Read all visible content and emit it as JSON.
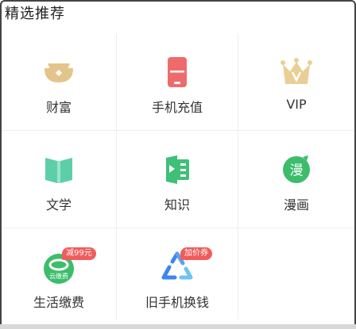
{
  "section": {
    "title": "精选推荐"
  },
  "items": [
    {
      "label": "财富",
      "icon": "gold-ingot-icon",
      "color": "#e3c58b"
    },
    {
      "label": "手机充值",
      "icon": "mobile-phone-icon",
      "color": "#ef6b6b"
    },
    {
      "label": "VIP",
      "icon": "crown-icon",
      "color": "#e9cf96"
    },
    {
      "label": "文学",
      "icon": "open-book-icon",
      "color": "#5ccfa8"
    },
    {
      "label": "知识",
      "icon": "knowledge-play-icon",
      "color": "#3fc078"
    },
    {
      "label": "漫画",
      "icon": "comic-icon",
      "color": "#3dbd6b",
      "icon_text": "漫"
    },
    {
      "label": "生活缴费",
      "icon": "cloud-payment-icon",
      "color": "#3dbd6b",
      "icon_text": "云缴费",
      "badge": "减99元"
    },
    {
      "label": "旧手机换钱",
      "icon": "recycle-triangle-icon",
      "color": "#3d86f0",
      "badge": "加价券"
    }
  ],
  "colors": {
    "badge": "#f25b5b",
    "divider": "#ededed"
  }
}
